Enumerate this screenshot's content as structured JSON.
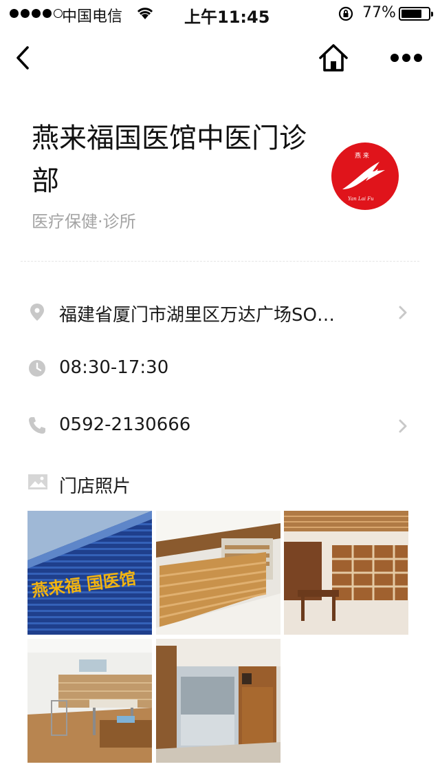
{
  "status_bar": {
    "carrier": "中国电信",
    "time": "上午11:45",
    "battery": "77%",
    "battery_level": 0.77
  },
  "nav": {
    "back_icon": "back-chevron-icon",
    "home_icon": "home-icon",
    "more_icon": "more-dots-icon"
  },
  "store": {
    "title": "燕来福国医馆中医门诊部",
    "category": "医疗保健·诊所",
    "address": "福建省厦门市湖里区万达广场SO…",
    "hours": "08:30-17:30",
    "phone": "0592-2130666"
  },
  "photos": {
    "label": "门店照片",
    "items": [
      {
        "name": "storefront-sign-photo",
        "sign_text": "燕来福  国医馆"
      },
      {
        "name": "reception-desk-photo"
      },
      {
        "name": "herbal-pharmacy-photo"
      },
      {
        "name": "treatment-room-photo"
      },
      {
        "name": "office-door-photo"
      }
    ]
  },
  "colors": {
    "logo_red": "#e0141b",
    "icon_gray": "#c8c8c8",
    "secondary_text": "#a4a4a4"
  }
}
